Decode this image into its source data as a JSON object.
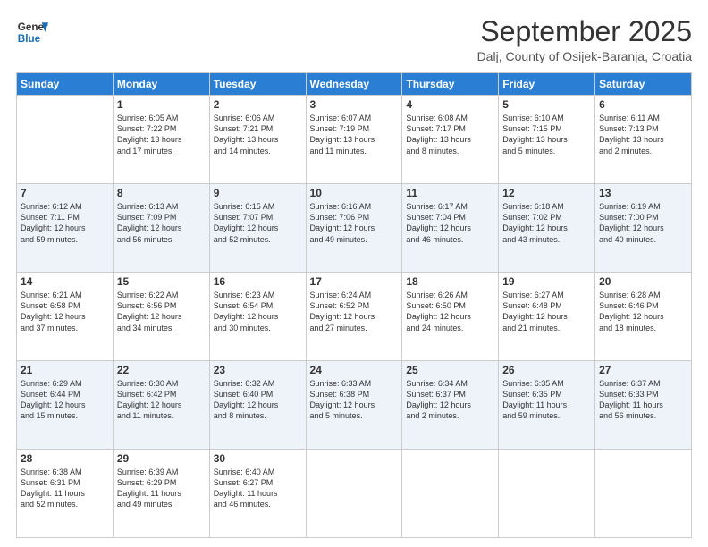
{
  "header": {
    "logo_line1": "General",
    "logo_line2": "Blue",
    "month": "September 2025",
    "location": "Dalj, County of Osijek-Baranja, Croatia"
  },
  "days_of_week": [
    "Sunday",
    "Monday",
    "Tuesday",
    "Wednesday",
    "Thursday",
    "Friday",
    "Saturday"
  ],
  "weeks": [
    [
      {
        "day": "",
        "info": ""
      },
      {
        "day": "1",
        "info": "Sunrise: 6:05 AM\nSunset: 7:22 PM\nDaylight: 13 hours\nand 17 minutes."
      },
      {
        "day": "2",
        "info": "Sunrise: 6:06 AM\nSunset: 7:21 PM\nDaylight: 13 hours\nand 14 minutes."
      },
      {
        "day": "3",
        "info": "Sunrise: 6:07 AM\nSunset: 7:19 PM\nDaylight: 13 hours\nand 11 minutes."
      },
      {
        "day": "4",
        "info": "Sunrise: 6:08 AM\nSunset: 7:17 PM\nDaylight: 13 hours\nand 8 minutes."
      },
      {
        "day": "5",
        "info": "Sunrise: 6:10 AM\nSunset: 7:15 PM\nDaylight: 13 hours\nand 5 minutes."
      },
      {
        "day": "6",
        "info": "Sunrise: 6:11 AM\nSunset: 7:13 PM\nDaylight: 13 hours\nand 2 minutes."
      }
    ],
    [
      {
        "day": "7",
        "info": "Sunrise: 6:12 AM\nSunset: 7:11 PM\nDaylight: 12 hours\nand 59 minutes."
      },
      {
        "day": "8",
        "info": "Sunrise: 6:13 AM\nSunset: 7:09 PM\nDaylight: 12 hours\nand 56 minutes."
      },
      {
        "day": "9",
        "info": "Sunrise: 6:15 AM\nSunset: 7:07 PM\nDaylight: 12 hours\nand 52 minutes."
      },
      {
        "day": "10",
        "info": "Sunrise: 6:16 AM\nSunset: 7:06 PM\nDaylight: 12 hours\nand 49 minutes."
      },
      {
        "day": "11",
        "info": "Sunrise: 6:17 AM\nSunset: 7:04 PM\nDaylight: 12 hours\nand 46 minutes."
      },
      {
        "day": "12",
        "info": "Sunrise: 6:18 AM\nSunset: 7:02 PM\nDaylight: 12 hours\nand 43 minutes."
      },
      {
        "day": "13",
        "info": "Sunrise: 6:19 AM\nSunset: 7:00 PM\nDaylight: 12 hours\nand 40 minutes."
      }
    ],
    [
      {
        "day": "14",
        "info": "Sunrise: 6:21 AM\nSunset: 6:58 PM\nDaylight: 12 hours\nand 37 minutes."
      },
      {
        "day": "15",
        "info": "Sunrise: 6:22 AM\nSunset: 6:56 PM\nDaylight: 12 hours\nand 34 minutes."
      },
      {
        "day": "16",
        "info": "Sunrise: 6:23 AM\nSunset: 6:54 PM\nDaylight: 12 hours\nand 30 minutes."
      },
      {
        "day": "17",
        "info": "Sunrise: 6:24 AM\nSunset: 6:52 PM\nDaylight: 12 hours\nand 27 minutes."
      },
      {
        "day": "18",
        "info": "Sunrise: 6:26 AM\nSunset: 6:50 PM\nDaylight: 12 hours\nand 24 minutes."
      },
      {
        "day": "19",
        "info": "Sunrise: 6:27 AM\nSunset: 6:48 PM\nDaylight: 12 hours\nand 21 minutes."
      },
      {
        "day": "20",
        "info": "Sunrise: 6:28 AM\nSunset: 6:46 PM\nDaylight: 12 hours\nand 18 minutes."
      }
    ],
    [
      {
        "day": "21",
        "info": "Sunrise: 6:29 AM\nSunset: 6:44 PM\nDaylight: 12 hours\nand 15 minutes."
      },
      {
        "day": "22",
        "info": "Sunrise: 6:30 AM\nSunset: 6:42 PM\nDaylight: 12 hours\nand 11 minutes."
      },
      {
        "day": "23",
        "info": "Sunrise: 6:32 AM\nSunset: 6:40 PM\nDaylight: 12 hours\nand 8 minutes."
      },
      {
        "day": "24",
        "info": "Sunrise: 6:33 AM\nSunset: 6:38 PM\nDaylight: 12 hours\nand 5 minutes."
      },
      {
        "day": "25",
        "info": "Sunrise: 6:34 AM\nSunset: 6:37 PM\nDaylight: 12 hours\nand 2 minutes."
      },
      {
        "day": "26",
        "info": "Sunrise: 6:35 AM\nSunset: 6:35 PM\nDaylight: 11 hours\nand 59 minutes."
      },
      {
        "day": "27",
        "info": "Sunrise: 6:37 AM\nSunset: 6:33 PM\nDaylight: 11 hours\nand 56 minutes."
      }
    ],
    [
      {
        "day": "28",
        "info": "Sunrise: 6:38 AM\nSunset: 6:31 PM\nDaylight: 11 hours\nand 52 minutes."
      },
      {
        "day": "29",
        "info": "Sunrise: 6:39 AM\nSunset: 6:29 PM\nDaylight: 11 hours\nand 49 minutes."
      },
      {
        "day": "30",
        "info": "Sunrise: 6:40 AM\nSunset: 6:27 PM\nDaylight: 11 hours\nand 46 minutes."
      },
      {
        "day": "",
        "info": ""
      },
      {
        "day": "",
        "info": ""
      },
      {
        "day": "",
        "info": ""
      },
      {
        "day": "",
        "info": ""
      }
    ]
  ]
}
